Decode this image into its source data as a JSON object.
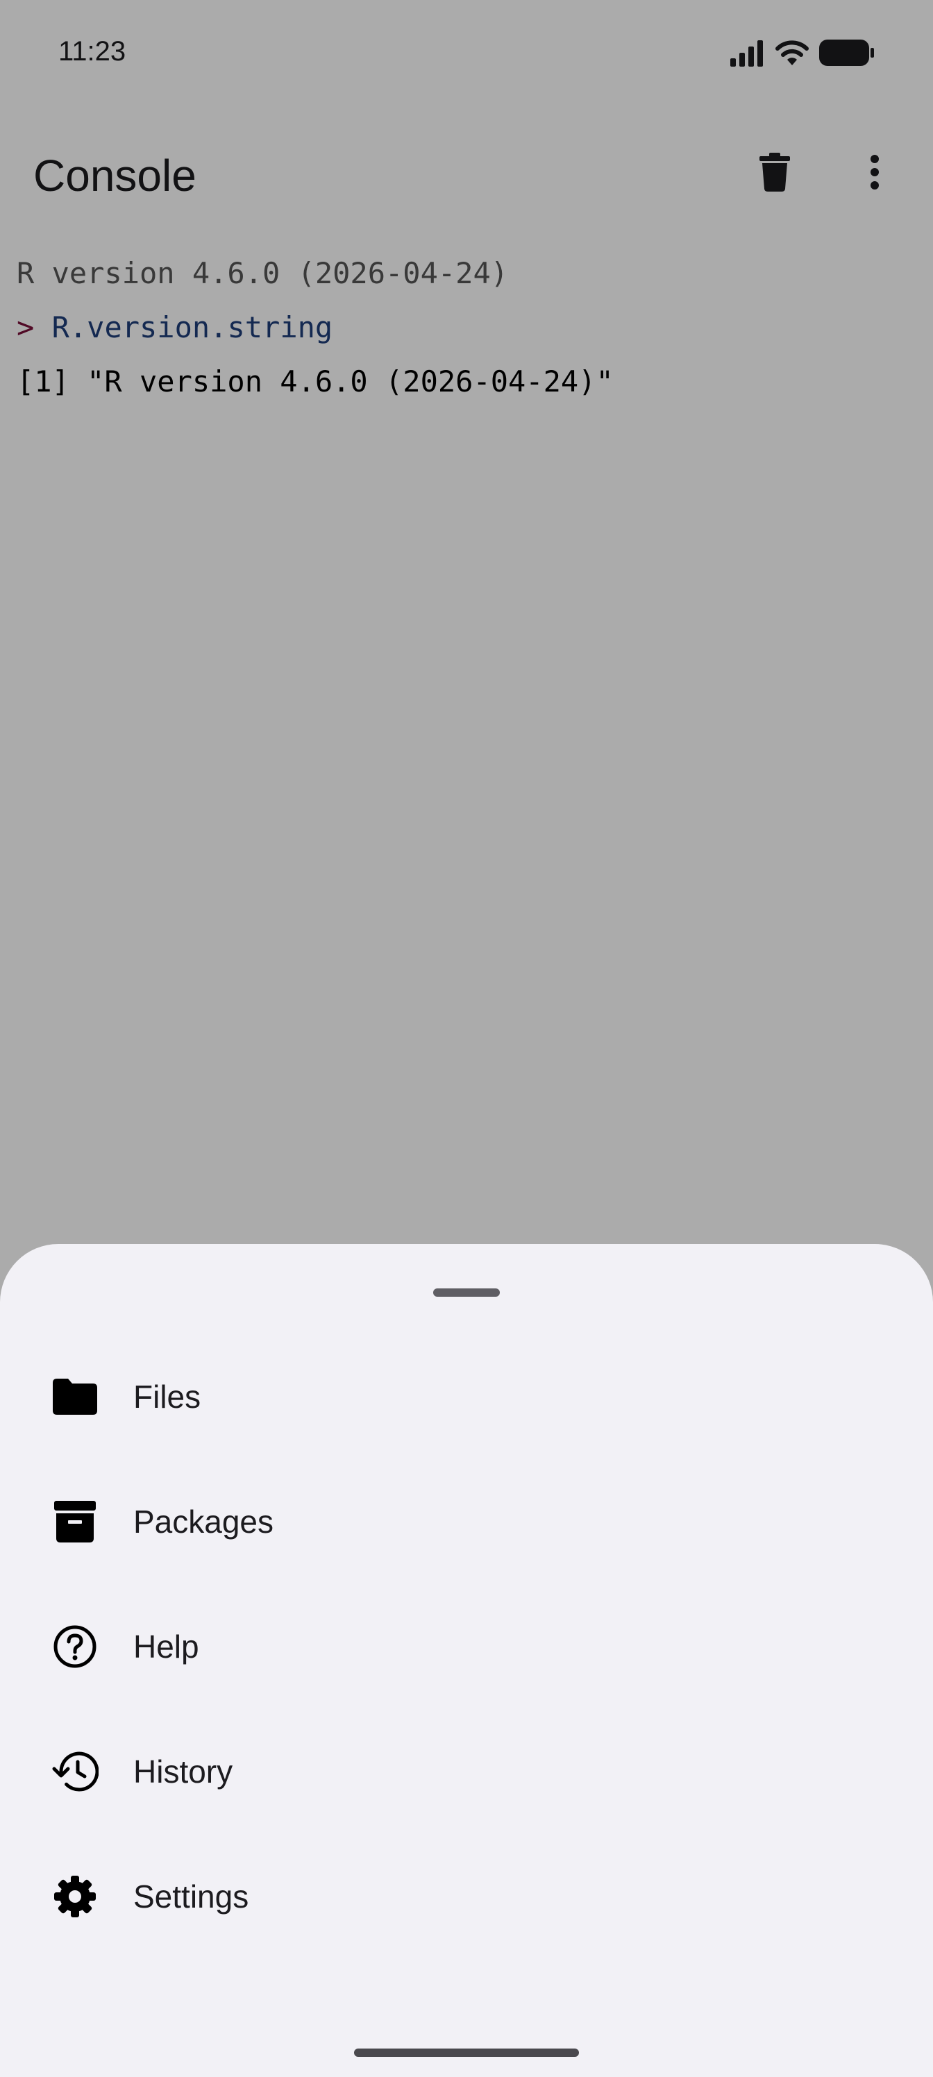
{
  "status_bar": {
    "time": "11:23",
    "icons": [
      "signal-icon",
      "wifi-icon",
      "battery-icon"
    ]
  },
  "app_bar": {
    "title": "Console",
    "actions": [
      "trash-icon",
      "more-vert-icon"
    ]
  },
  "console": {
    "banner": "R version 4.6.0 (2026-04-24)",
    "prompt": ">",
    "input": "R.version.string",
    "output": "[1] \"R version 4.6.0 (2026-04-24)\""
  },
  "colors": {
    "sheet_background": "#f2f1f6",
    "prompt": "#7a0f3a",
    "input_code": "#1f3e7a",
    "banner_text": "#555555"
  },
  "sheet": {
    "items": [
      {
        "label": "Files",
        "icon": "folder-icon"
      },
      {
        "label": "Packages",
        "icon": "archive-icon"
      },
      {
        "label": "Help",
        "icon": "help-circle-icon"
      },
      {
        "label": "History",
        "icon": "history-icon"
      },
      {
        "label": "Settings",
        "icon": "gear-icon"
      }
    ]
  }
}
